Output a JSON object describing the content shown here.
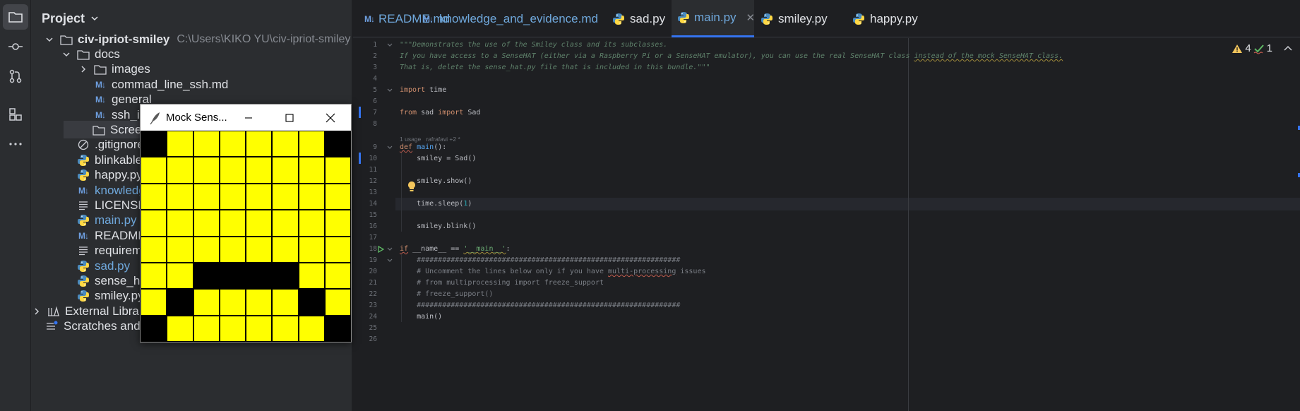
{
  "activity_bar": {
    "items": [
      "project-icon",
      "commit-icon",
      "pull-requests-icon",
      "structure-icon",
      "more-icon"
    ]
  },
  "project_panel": {
    "title": "Project",
    "root": {
      "name": "civ-ipriot-smiley",
      "path": "C:\\Users\\KIKO YU\\civ-ipriot-smiley"
    },
    "tree": [
      {
        "label": "docs",
        "type": "folder",
        "level": 1,
        "expanded": true
      },
      {
        "label": "images",
        "type": "folder",
        "level": 2,
        "expanded": false
      },
      {
        "label": "commad_line_ssh.md",
        "type": "md",
        "level": 2
      },
      {
        "label": "general",
        "type": "md",
        "level": 2
      },
      {
        "label": "ssh_in_",
        "type": "md",
        "level": 2
      },
      {
        "label": "Screensho",
        "type": "folder",
        "level": 1
      },
      {
        "label": ".gitignore",
        "type": "ignore",
        "level": 1
      },
      {
        "label": "blinkable.py",
        "type": "py",
        "level": 1
      },
      {
        "label": "happy.py",
        "type": "py",
        "level": 1
      },
      {
        "label": "knowledge",
        "type": "md",
        "level": 1,
        "modified": true
      },
      {
        "label": "LICENSE",
        "type": "text",
        "level": 1
      },
      {
        "label": "main.py",
        "type": "py",
        "level": 1,
        "modified": true
      },
      {
        "label": "README.n",
        "type": "md",
        "level": 1
      },
      {
        "label": "requireme",
        "type": "text",
        "level": 1
      },
      {
        "label": "sad.py",
        "type": "py",
        "level": 1,
        "modified": true
      },
      {
        "label": "sense_hat",
        "type": "py",
        "level": 1
      },
      {
        "label": "smiley.py",
        "type": "py",
        "level": 1
      }
    ],
    "external_libraries": "External Libraries",
    "scratches": "Scratches and Consoles"
  },
  "mock_window": {
    "title": "Mock Sens...",
    "pixels": [
      [
        "K",
        "Y",
        "Y",
        "Y",
        "Y",
        "Y",
        "Y",
        "K"
      ],
      [
        "Y",
        "Y",
        "Y",
        "Y",
        "Y",
        "Y",
        "Y",
        "Y"
      ],
      [
        "Y",
        "Y",
        "Y",
        "Y",
        "Y",
        "Y",
        "Y",
        "Y"
      ],
      [
        "Y",
        "Y",
        "Y",
        "Y",
        "Y",
        "Y",
        "Y",
        "Y"
      ],
      [
        "Y",
        "Y",
        "Y",
        "Y",
        "Y",
        "Y",
        "Y",
        "Y"
      ],
      [
        "Y",
        "Y",
        "K",
        "K",
        "K",
        "K",
        "Y",
        "Y"
      ],
      [
        "Y",
        "K",
        "Y",
        "Y",
        "Y",
        "Y",
        "K",
        "Y"
      ],
      [
        "K",
        "Y",
        "Y",
        "Y",
        "Y",
        "Y",
        "Y",
        "K"
      ]
    ],
    "colors": {
      "Y": "#ffff00",
      "K": "#000000"
    }
  },
  "tabs": [
    {
      "label": "README.md",
      "type": "md",
      "active": false
    },
    {
      "label": "knowledge_and_evidence.md",
      "type": "md",
      "active": false
    },
    {
      "label": "sad.py",
      "type": "py",
      "active": false
    },
    {
      "label": "main.py",
      "type": "py",
      "active": true
    },
    {
      "label": "smiley.py",
      "type": "py",
      "active": false
    },
    {
      "label": "happy.py",
      "type": "py",
      "active": false
    }
  ],
  "inspections": {
    "warnings": "4",
    "weak_warnings": "1"
  },
  "usage_hint": "1 usage   rafrafavi +2 *",
  "code_lines": [
    {
      "n": "1",
      "tokens": [
        [
          "doc",
          "\"\"\"Demonstrates the use of the Smiley class and its subclasses."
        ]
      ]
    },
    {
      "n": "2",
      "tokens": [
        [
          "doc",
          "If you have access to a SenseHAT (either via a Raspberry Pi or a SenseHAT emulator), you can use the real SenseHAT class "
        ],
        [
          "docsq",
          "instead of the mock SenseHAT class."
        ]
      ]
    },
    {
      "n": "3",
      "tokens": [
        [
          "doc",
          "That is, delete the sense_hat.py file that is included in this bundle.\"\"\""
        ]
      ]
    },
    {
      "n": "4",
      "tokens": []
    },
    {
      "n": "5",
      "tokens": [
        [
          "k",
          "import"
        ],
        [
          "plain",
          " time"
        ]
      ]
    },
    {
      "n": "6",
      "tokens": []
    },
    {
      "n": "7",
      "tokens": [
        [
          "k",
          "from"
        ],
        [
          "plain",
          " sad "
        ],
        [
          "k",
          "import"
        ],
        [
          "plain",
          " Sad"
        ]
      ]
    },
    {
      "n": "8",
      "tokens": []
    },
    {
      "n": "9",
      "tokens": [
        [
          "ksq",
          "def"
        ],
        [
          "plain",
          " "
        ],
        [
          "fn",
          "main"
        ],
        [
          "plain",
          "():"
        ]
      ]
    },
    {
      "n": "10",
      "tokens": [
        [
          "plain",
          "    smiley = Sad()"
        ]
      ]
    },
    {
      "n": "11",
      "tokens": []
    },
    {
      "n": "12",
      "tokens": [
        [
          "plain",
          "    smiley.show()"
        ]
      ]
    },
    {
      "n": "13",
      "tokens": []
    },
    {
      "n": "14",
      "tokens": [
        [
          "plain",
          "    time.sleep("
        ],
        [
          "num",
          "1"
        ],
        [
          "plain",
          ")"
        ]
      ]
    },
    {
      "n": "15",
      "tokens": []
    },
    {
      "n": "16",
      "tokens": [
        [
          "plain",
          "    smiley.blink()"
        ]
      ]
    },
    {
      "n": "17",
      "tokens": []
    },
    {
      "n": "18",
      "tokens": [
        [
          "ksq",
          "if"
        ],
        [
          "plain",
          " __name__ == "
        ],
        [
          "strsq",
          "'__main__'"
        ],
        [
          "plain",
          ":"
        ]
      ]
    },
    {
      "n": "19",
      "tokens": [
        [
          "cm",
          "    ##############################################################"
        ]
      ]
    },
    {
      "n": "20",
      "tokens": [
        [
          "cm",
          "    # Uncomment the lines below only if you have "
        ],
        [
          "cmsq",
          "multi-processing"
        ],
        [
          "cm",
          " issues"
        ]
      ]
    },
    {
      "n": "21",
      "tokens": [
        [
          "cm",
          "    # from multiprocessing import freeze_support"
        ]
      ]
    },
    {
      "n": "22",
      "tokens": [
        [
          "cm",
          "    # freeze_support()"
        ]
      ]
    },
    {
      "n": "23",
      "tokens": [
        [
          "cm",
          "    ##############################################################"
        ]
      ]
    },
    {
      "n": "24",
      "tokens": [
        [
          "plain",
          "    main()"
        ]
      ]
    },
    {
      "n": "25",
      "tokens": []
    },
    {
      "n": "26",
      "tokens": []
    }
  ]
}
